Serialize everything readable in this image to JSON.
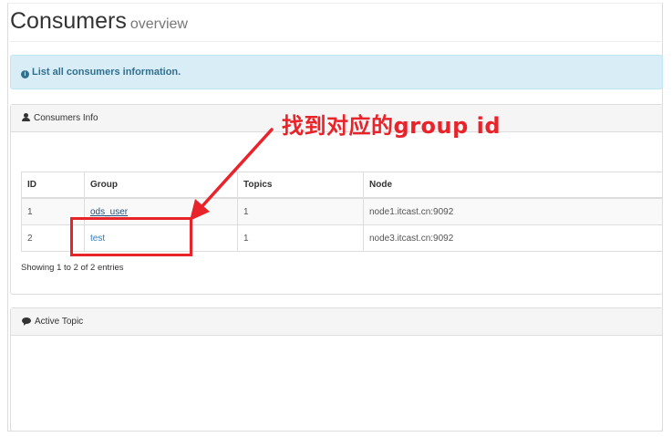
{
  "page": {
    "title": "Consumers",
    "subtitle": "overview"
  },
  "alert": {
    "icon": "info-icon",
    "text": "List all consumers information."
  },
  "consumers_panel": {
    "title": "Consumers Info",
    "icon": "user-icon",
    "table": {
      "columns": [
        "ID",
        "Group",
        "Topics",
        "Node"
      ],
      "rows": [
        {
          "id": "1",
          "group": "ods_user",
          "topics": "1",
          "node": "node1.itcast.cn:9092"
        },
        {
          "id": "2",
          "group": "test",
          "topics": "1",
          "node": "node3.itcast.cn:9092"
        }
      ]
    },
    "entries_info": "Showing 1 to 2 of 2 entries"
  },
  "topic_panel": {
    "title": "Active Topic",
    "icon": "comment-icon"
  },
  "annotation": {
    "text": "找到对应的group id",
    "color": "#e8232a"
  },
  "colors": {
    "alert_bg": "#d9edf7",
    "alert_text": "#31708f",
    "link": "#337ab7",
    "annotation": "#e8232a"
  }
}
